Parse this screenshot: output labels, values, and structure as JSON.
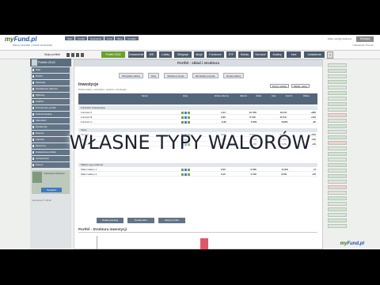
{
  "header": {
    "logo_main": "my",
    "logo_fund": "Fund.pl",
    "tagline": "Wiemy wszystko o twoich funduszach",
    "menu_tabs": [
      "Start",
      "Portfel",
      "Notowania",
      "Fora",
      "Blog",
      "Kontakt"
    ],
    "right_text": "Witaj, user@myfund.pl",
    "logout_label": "Wyloguj",
    "right_sub": "Ustawienia | Pomoc"
  },
  "toolbar": {
    "label": "Moje portfele",
    "green_label": "Portfel 2016",
    "buttons": [
      "Zestawienie",
      "IKE",
      "Lokaty",
      "Obligacje",
      "Akcje",
      "Fundusze",
      "ETF",
      "Waluty",
      "Surowce",
      "Analizy",
      "Inne",
      "Ustawienia"
    ],
    "badge": "?"
  },
  "sidebar": {
    "title": "Portfel 2016",
    "items": [
      "Start",
      "Portfel",
      "Operacje",
      "Zestawienie walorów",
      "Wykresy",
      "Analiza",
      "Porównanie portfeli",
      "Podsumowanie",
      "Kalendarz",
      "Dywidendy",
      "Raporty",
      "Importuj",
      "Eksportuj",
      "Ustawienia portfela",
      "Uprawnienia",
      "Pomoc"
    ],
    "ad_text": "myFund.pl Premium",
    "ad_button": "Sprawdź",
    "footer": "myFund.pl © 2016"
  },
  "main": {
    "title": "Portfel - skład i struktura",
    "filters": [
      "Wszystkie walory",
      "Daty",
      "Otwarte pozycje",
      "Zamknięte pozycje",
      "Grupuj walory"
    ],
    "section_title": "Inwestycje",
    "section_sub": "Pokaż walory: wszystkie | otwarte | zamknięte",
    "selects": [
      "Sortuj: nazwa",
      "Widok: pełny"
    ],
    "table_headers": [
      "Nazwa",
      "Akcje",
      "Zmiana dzienna",
      "Wartość",
      "Udział",
      "Zysk",
      "Zysk %",
      "Waluta"
    ],
    "groups": [
      "Fundusze inwestycyjne",
      "Akcje",
      "Własne typy walorów"
    ],
    "rows": [
      {
        "name": "Fundusz A",
        "v1": "1,24",
        "v2": "12 450",
        "v3": "24,1%",
        "v4": "+320"
      },
      {
        "name": "Fundusz B",
        "v1": "0,85",
        "v2": "8 120",
        "v3": "15,7%",
        "v4": "+110"
      },
      {
        "name": "Fundusz C",
        "v1": "-0,32",
        "v2": "5 600",
        "v3": "10,8%",
        "v4": "-45"
      },
      {
        "name": "Akcje X",
        "v1": "2,10",
        "v2": "7 300",
        "v3": "14,1%",
        "v4": "+510"
      },
      {
        "name": "Akcje Y",
        "v1": "-1,05",
        "v2": "4 900",
        "v3": "9,5%",
        "v4": "-120"
      },
      {
        "name": "Akcje Z",
        "v1": "0,44",
        "v2": "3 200",
        "v3": "6,2%",
        "v4": "+60"
      },
      {
        "name": "Walor własny 1",
        "v1": "0,00",
        "v2": "6 000",
        "v3": "11,6%",
        "v4": "+0"
      },
      {
        "name": "Walor własny 2",
        "v1": "0,12",
        "v2": "4 150",
        "v3": "8,0%",
        "v4": "+25"
      }
    ],
    "buttons": [
      "Dodaj operację",
      "Dodaj walor",
      "Edytuj portfel"
    ],
    "chart_title": "Portfel - Struktura inwestycji"
  },
  "overlay_title": "WŁASNE TYPY WALORÓW",
  "bottom_logo_main": "my",
  "bottom_logo_fund": "Fund.pl"
}
